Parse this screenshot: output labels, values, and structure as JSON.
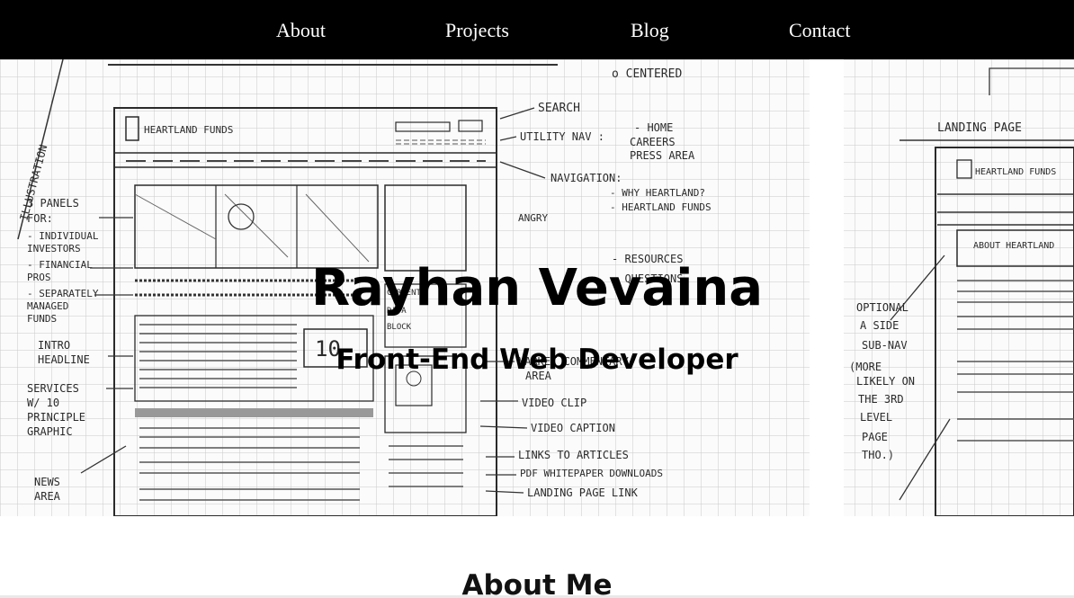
{
  "nav": {
    "items": [
      {
        "label": "About"
      },
      {
        "label": "Projects"
      },
      {
        "label": "Blog"
      },
      {
        "label": "Contact"
      }
    ]
  },
  "hero": {
    "title": "Rayhan Vevaina",
    "subtitle": "Front-End Web Developer"
  },
  "about": {
    "heading": "About Me"
  },
  "sketch": {
    "left_notes": [
      "3 PANELS",
      "FOR:",
      "- INDIVIDUAL",
      "  INVESTORS",
      "- FINANCIAL",
      "  PROS",
      "- SEPARATELY",
      "  MANAGED",
      "  FUNDS",
      "INTRO",
      "HEADLINE",
      "SERVICES",
      "W/ 10",
      "PRINCIPLE",
      "GRAPHIC",
      "NEWS",
      "AREA"
    ],
    "right_notes": [
      "o CENTERED",
      "SEARCH",
      "UTILITY NAV :",
      "- HOME",
      "  CAREERS",
      "  PRESS AREA",
      "NAVIGATION:",
      "- WHY HEARTLAND?",
      "- HEARTLAND FUNDS",
      "- RESOURCES",
      "- QUESTIONS",
      "MARKET COMMENTARY",
      "AREA",
      "VIDEO CLIP",
      "VIDEO CAPTION",
      "LINKS TO ARTICLES",
      "PDF WHITEPAPER DOWNLOADS",
      "LANDING PAGE LINK"
    ],
    "far_notes": [
      "LANDING PAGE",
      "OPTIONAL",
      "A SIDE",
      "SUB-NAV",
      "(MORE",
      "LIKELY ON",
      "THE 3RD",
      "LEVEL",
      "PAGE",
      "THO.)"
    ],
    "logo_text": "HEARTLAND FUNDS",
    "mini_logo_text": "HEARTLAND FUNDS",
    "about_tag": "ABOUT HEARTLAND",
    "badge": "10",
    "top_label": "ILLUSTRATION",
    "frag_1": "ANGRY",
    "frag_2": "CURRENT",
    "frag_3": "DATA",
    "frag_4": "BLOCK"
  }
}
